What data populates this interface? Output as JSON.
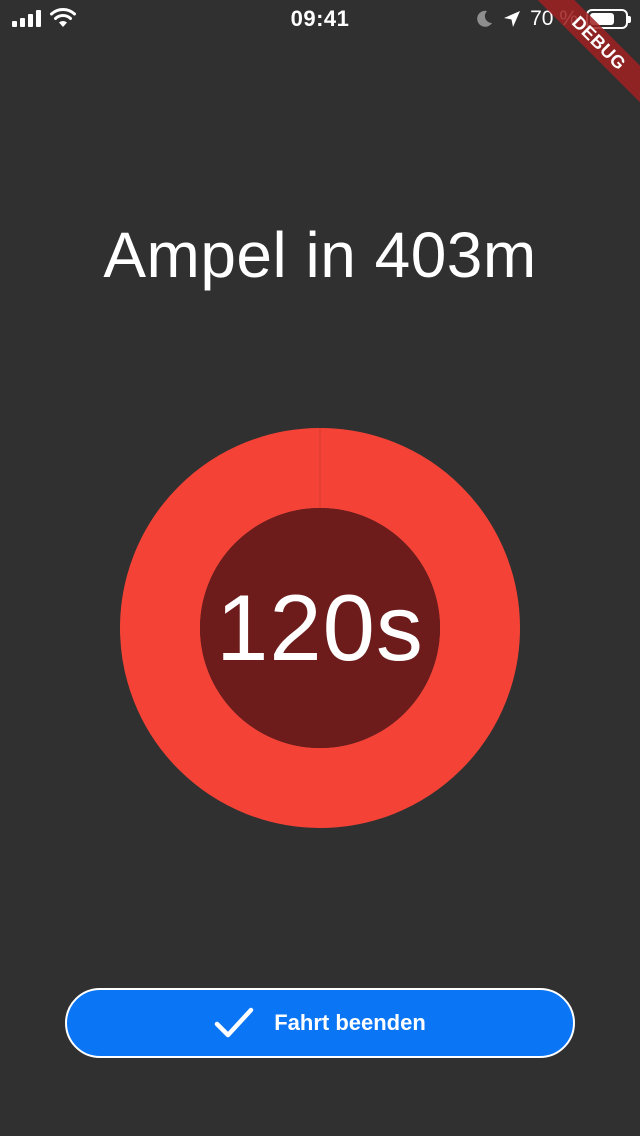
{
  "status_bar": {
    "time": "09:41",
    "battery_text": "70 %",
    "battery_level": 0.7,
    "icons": [
      "signal-icon",
      "wifi-icon",
      "moon-icon",
      "location-arrow-icon",
      "battery-icon"
    ]
  },
  "debug_banner": {
    "label": "DEBUG"
  },
  "header": {
    "title": "Ampel in 403m"
  },
  "timer": {
    "value": "120s",
    "progress": 1.0,
    "colors": {
      "ring": "#f44336",
      "center": "#6d1b1b"
    }
  },
  "actions": {
    "end_label": "Fahrt beenden",
    "end_icon": "check-icon",
    "button_color": "#0a76f6"
  },
  "colors": {
    "background": "#303030",
    "text": "#ffffff"
  }
}
